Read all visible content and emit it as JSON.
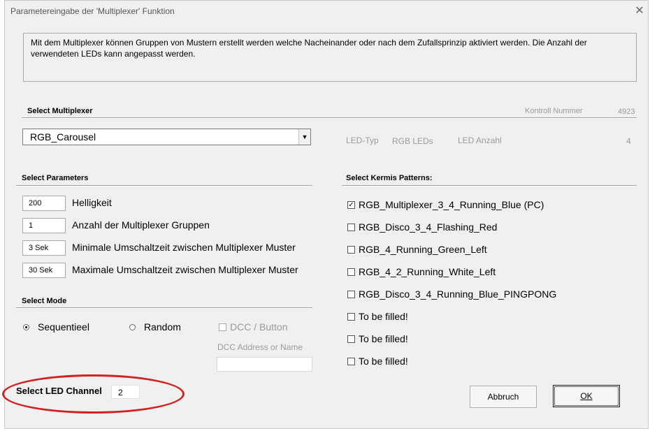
{
  "window": {
    "title": "Parametereingabe der 'Multiplexer' Funktion",
    "close_glyph": "✕"
  },
  "info_text": "Mit dem Multiplexer können Gruppen von Mustern erstellt werden welche Nacheinander oder nach dem Zufallsprinzip aktiviert werden. Die Anzahl der verwendeten LEDs kann angepasst werden.",
  "multiplexer": {
    "section_label": "Select Multiplexer",
    "kontroll_label": "Kontroll Nummer",
    "kontroll_value": "4923",
    "selected": "RGB_Carousel",
    "led_typ_label": "LED-Typ",
    "led_typ_value": "RGB LEDs",
    "led_anzahl_label": "LED Anzahl",
    "led_anzahl_value": "4"
  },
  "parameters": {
    "section_label": "Select Parameters",
    "rows": [
      {
        "value": "200",
        "label": "Helligkeit"
      },
      {
        "value": "1",
        "label": "Anzahl der Multiplexer Gruppen"
      },
      {
        "value": "3 Sek",
        "label": "Minimale Umschaltzeit zwischen Multiplexer Muster"
      },
      {
        "value": "30 Sek",
        "label": "Maximale Umschaltzeit zwischen Multiplexer Muster"
      }
    ]
  },
  "mode": {
    "section_label": "Select Mode",
    "sequential_label": "Sequentieel",
    "sequential_selected": true,
    "random_label": "Random",
    "random_selected": false,
    "dcc_label": "DCC / Button",
    "dcc_checked": false,
    "dcc_address_label": "DCC Address or Name",
    "dcc_address_value": ""
  },
  "led_channel": {
    "label": "Select LED Channel",
    "value": "2"
  },
  "patterns": {
    "section_label": "Select Kermis Patterns:",
    "items": [
      {
        "label": "RGB_Multiplexer_3_4_Running_Blue (PC)",
        "checked": true
      },
      {
        "label": "RGB_Disco_3_4_Flashing_Red",
        "checked": false
      },
      {
        "label": "RGB_4_Running_Green_Left",
        "checked": false
      },
      {
        "label": "RGB_4_2_Running_White_Left",
        "checked": false
      },
      {
        "label": "RGB_Disco_3_4_Running_Blue_PINGPONG",
        "checked": false
      },
      {
        "label": "To be filled!",
        "checked": false
      },
      {
        "label": "To be filled!",
        "checked": false
      },
      {
        "label": "To be filled!",
        "checked": false
      }
    ]
  },
  "buttons": {
    "cancel": "Abbruch",
    "ok": "OK"
  },
  "colors": {
    "dialog_bg": "#f0f0f0",
    "highlight": "#d32020"
  }
}
